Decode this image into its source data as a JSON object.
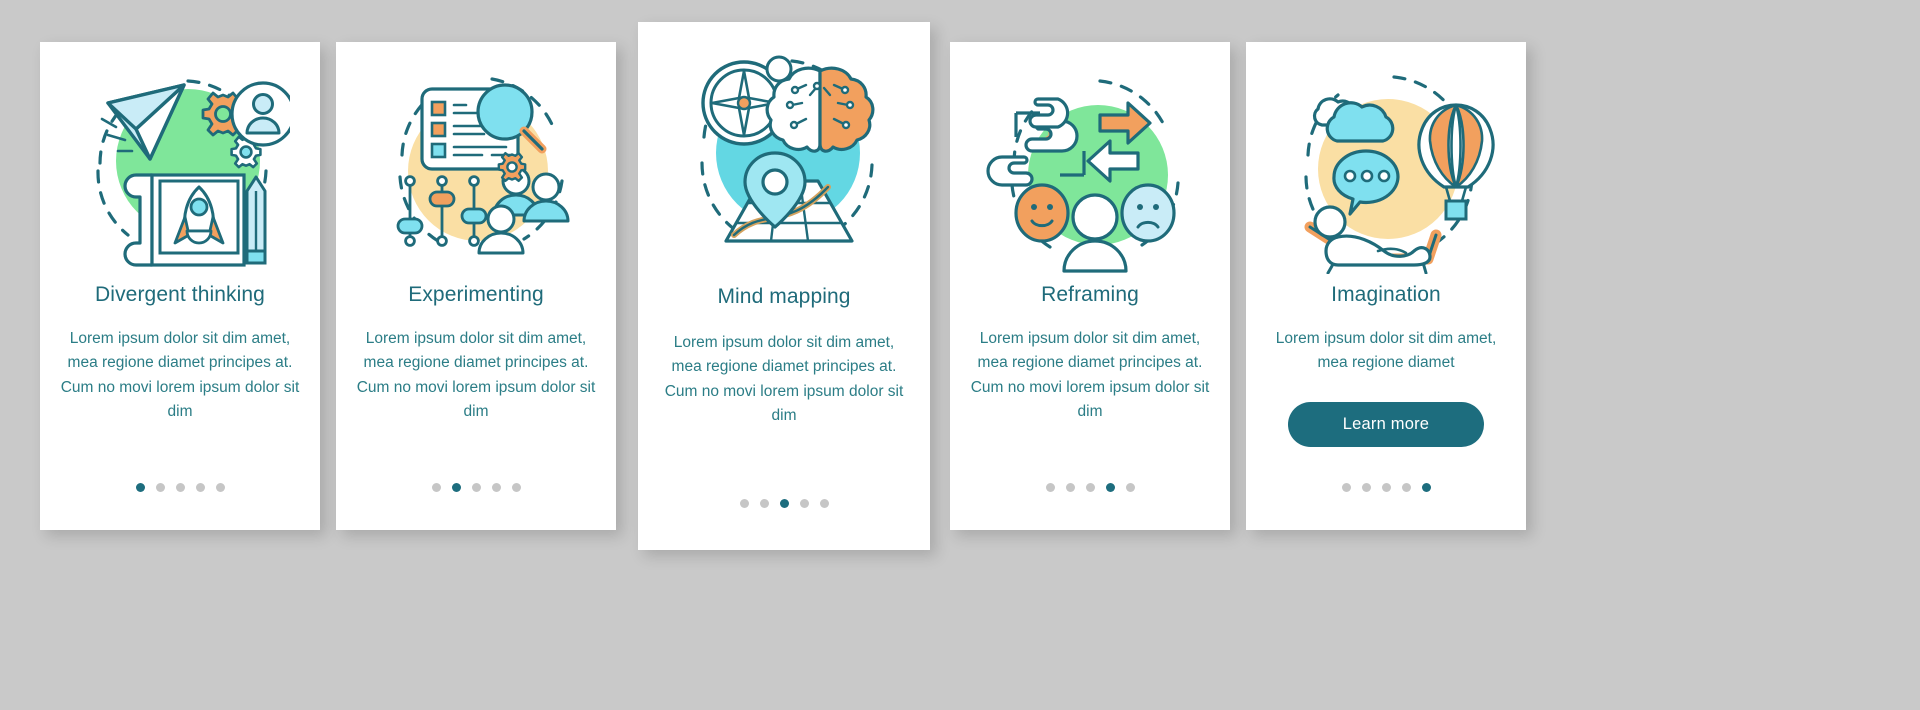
{
  "page": {
    "background_color": "#c9c9c9",
    "card_background": "#ffffff",
    "title_color": "#1f6b7a",
    "body_color": "#2b7d86",
    "accent_color": "#1d6d7e",
    "dot_inactive_color": "#c6c6c6",
    "palette": {
      "teal_line": "#1f6b7a",
      "light_cyan": "#7fe0ef",
      "orange": "#f2a05e",
      "green_blob": "#7fe69a",
      "yellow_blob": "#fadfa4",
      "cyan_blob": "#63d7e3",
      "pale_blue": "#c9ecf7"
    }
  },
  "cards": [
    {
      "id": "divergent-thinking",
      "icon": "paper-plane-rocket-blueprint-icon",
      "title": "Divergent thinking",
      "description": "Lorem ipsum dolor sit dim amet, mea regione diamet principes at. Cum no movi lorem ipsum dolor sit dim",
      "dots": {
        "count": 5,
        "active": 1
      },
      "button": null
    },
    {
      "id": "experimenting",
      "icon": "checklist-magnifier-sliders-icon",
      "title": "Experimenting",
      "description": "Lorem ipsum dolor sit dim amet, mea regione diamet principes at. Cum no movi lorem ipsum dolor sit dim",
      "dots": {
        "count": 5,
        "active": 2
      },
      "button": null
    },
    {
      "id": "mind-mapping",
      "icon": "compass-brain-map-pin-icon",
      "title": "Mind mapping",
      "description": "Lorem ipsum dolor sit dim amet, mea regione diamet principes at. Cum no movi lorem ipsum dolor sit dim",
      "dots": {
        "count": 5,
        "active": 3
      },
      "button": null
    },
    {
      "id": "reframing",
      "icon": "hands-frame-arrows-faces-icon",
      "title": "Reframing",
      "description": "Lorem ipsum dolor sit dim amet, mea regione diamet principes at. Cum no movi lorem ipsum dolor sit dim",
      "dots": {
        "count": 5,
        "active": 4
      },
      "button": null
    },
    {
      "id": "imagination",
      "icon": "daydream-cloud-balloon-lounger-icon",
      "title": "Imagination",
      "description": "Lorem ipsum dolor sit dim amet, mea regione diamet",
      "dots": {
        "count": 5,
        "active": 5
      },
      "button": {
        "label": "Learn more"
      }
    }
  ]
}
